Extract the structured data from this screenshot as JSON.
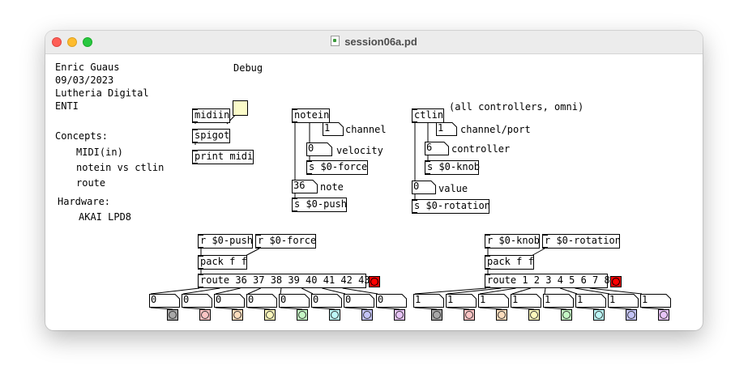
{
  "window": {
    "title": "session06a.pd"
  },
  "info": {
    "author": "Enric Guaus",
    "date": "09/03/2023",
    "course": "Lutheria Digital",
    "school": "ENTI",
    "concepts_title": "Concepts:",
    "concepts": [
      "MIDI(in)",
      "notein vs ctlin",
      "route"
    ],
    "hardware_title": "Hardware:",
    "hardware": "AKAI LPD8"
  },
  "debug": {
    "label": "Debug",
    "midiin": "midiin",
    "spigot": "spigot",
    "print": "print midi"
  },
  "notein": {
    "obj": "notein",
    "channel_value": "1",
    "channel_label": "channel",
    "velocity_value": "0",
    "velocity_label": "velocity",
    "send_force": "s $0-force",
    "note_value": "36",
    "note_label": "note",
    "send_push": "s $0-push"
  },
  "ctlin": {
    "obj": "ctlin",
    "comment": "(all controllers, omni)",
    "channel_value": "1",
    "channel_label": "channel/port",
    "controller_value": "6",
    "controller_label": "controller",
    "send_knob": "s $0-knob",
    "value_value": "0",
    "value_label": "value",
    "send_rotation": "s $0-rotation"
  },
  "left_group": {
    "recv_push": "r $0-push",
    "recv_force": "r $0-force",
    "pack": "pack f f",
    "route": "route 36 37 38 39 40 41 42 43",
    "numbers": [
      "0",
      "0",
      "0",
      "0",
      "0",
      "0",
      "0",
      "0"
    ]
  },
  "right_group": {
    "recv_knob": "r $0-knob",
    "recv_rotation": "r $0-rotation",
    "pack": "pack f f",
    "route": "route 1 2 3 4 5 6 7 8",
    "numbers": [
      "1",
      "1",
      "1",
      "1",
      "1",
      "1",
      "1",
      "1"
    ]
  },
  "colors": {
    "left_bangs": [
      "#a8a8a8",
      "#fcc4c4",
      "#fcdcbc",
      "#fcf8bc",
      "#c4f8c4",
      "#bcf8f8",
      "#c4c4f8",
      "#e8c4f8"
    ],
    "right_bangs": [
      "#a8a8a8",
      "#fcc4c4",
      "#fcdcbc",
      "#fcf8bc",
      "#c4f8c4",
      "#bcf8f8",
      "#c4c4f8",
      "#e8c4f8"
    ],
    "toggle": "#fbfbc8",
    "bang_active": "#ff0000"
  }
}
